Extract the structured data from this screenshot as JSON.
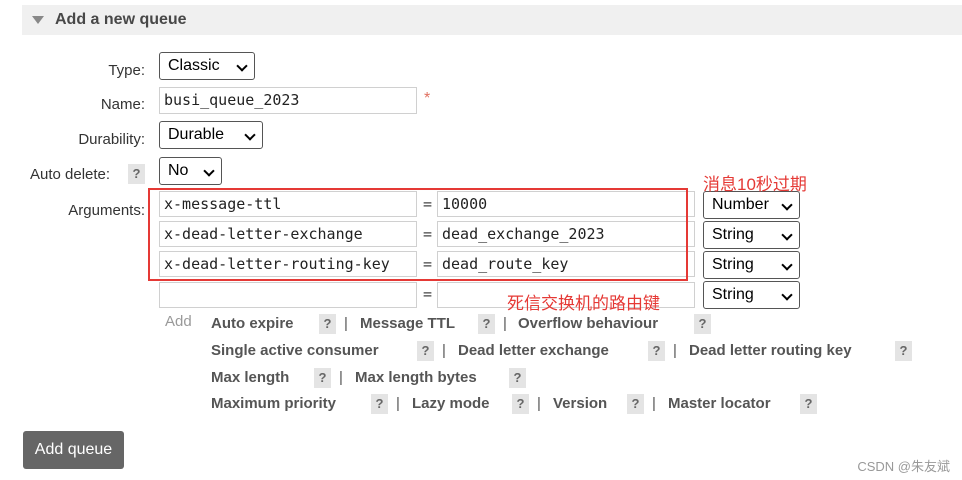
{
  "header": {
    "title": "Add a new queue"
  },
  "form": {
    "type": {
      "label": "Type:",
      "value": "Classic"
    },
    "name": {
      "label": "Name:",
      "value": "busi_queue_2023",
      "required_mark": "*"
    },
    "durability": {
      "label": "Durability:",
      "value": "Durable"
    },
    "auto_delete": {
      "label": "Auto delete:",
      "help": "?",
      "value": "No"
    },
    "arguments": {
      "label": "Arguments:",
      "rows": [
        {
          "key": "x-message-ttl",
          "eq": "=",
          "value": "10000",
          "type": "Number"
        },
        {
          "key": "x-dead-letter-exchange",
          "eq": "=",
          "value": "dead_exchange_2023",
          "type": "String"
        },
        {
          "key": "x-dead-letter-routing-key",
          "eq": "=",
          "value": "dead_route_key",
          "type": "String"
        },
        {
          "key": "",
          "eq": "=",
          "value": "",
          "type": "String"
        }
      ]
    },
    "add_label": "Add",
    "help": "?",
    "sep": "|",
    "properties": [
      [
        "Auto expire",
        "Message TTL",
        "Overflow behaviour"
      ],
      [
        "Single active consumer",
        "Dead letter exchange",
        "Dead letter routing key"
      ],
      [
        "Max length",
        "Max length bytes"
      ],
      [
        "Maximum priority",
        "Lazy mode",
        "Version",
        "Master locator"
      ]
    ]
  },
  "annotations": {
    "ttl_note": "消息10秒过期",
    "routing_note": "死信交换机的路由键"
  },
  "buttons": {
    "add_queue": "Add queue"
  },
  "watermark": "CSDN @朱友斌"
}
